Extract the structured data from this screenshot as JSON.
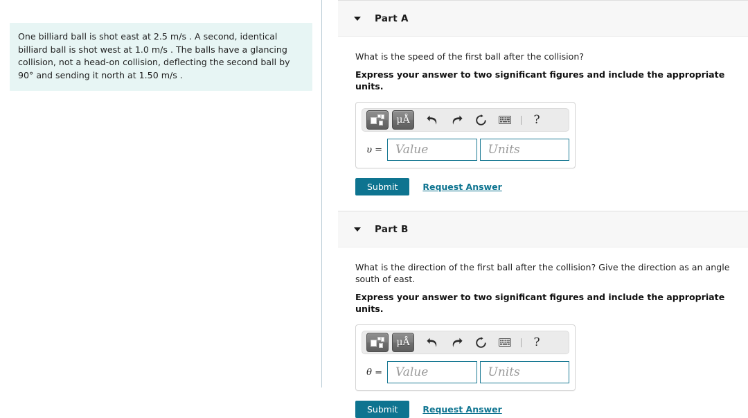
{
  "problem": {
    "statement": "One billiard ball is shot east at 2.5 m/s . A second, identical billiard ball is shot west at 1.0 m/s . The balls have a glancing collision, not a head-on collision, deflecting the second ball by 90° and sending it north at 1.50 m/s ."
  },
  "colors": {
    "accent": "#0e7490",
    "problem_box_bg": "#e7f5f4",
    "header_bg": "#f7f7f7",
    "field_border": "#1b7a94",
    "divider": "#b9ccd6"
  },
  "toolbar": {
    "template_icon": "math-template-icon",
    "units_icon_label": "μÅ",
    "undo_icon": "undo-icon",
    "redo_icon": "redo-icon",
    "reset_icon": "reset-icon",
    "keyboard_icon": "keyboard-icon",
    "help_label": "?"
  },
  "fields": {
    "value_placeholder": "Value",
    "units_placeholder": "Units",
    "value_current": "",
    "units_current": ""
  },
  "actions": {
    "submit_label": "Submit",
    "request_answer_label": "Request Answer"
  },
  "parts": [
    {
      "title": "Part A",
      "question": "What is the speed of the first ball after the collision?",
      "instruction": "Express your answer to two significant figures and include the appropriate units.",
      "variable": "υ ="
    },
    {
      "title": "Part B",
      "question": "What is the direction of the first ball after the collision? Give the direction as an angle south of east.",
      "instruction": "Express your answer to two significant figures and include the appropriate units.",
      "variable": "θ ="
    }
  ]
}
